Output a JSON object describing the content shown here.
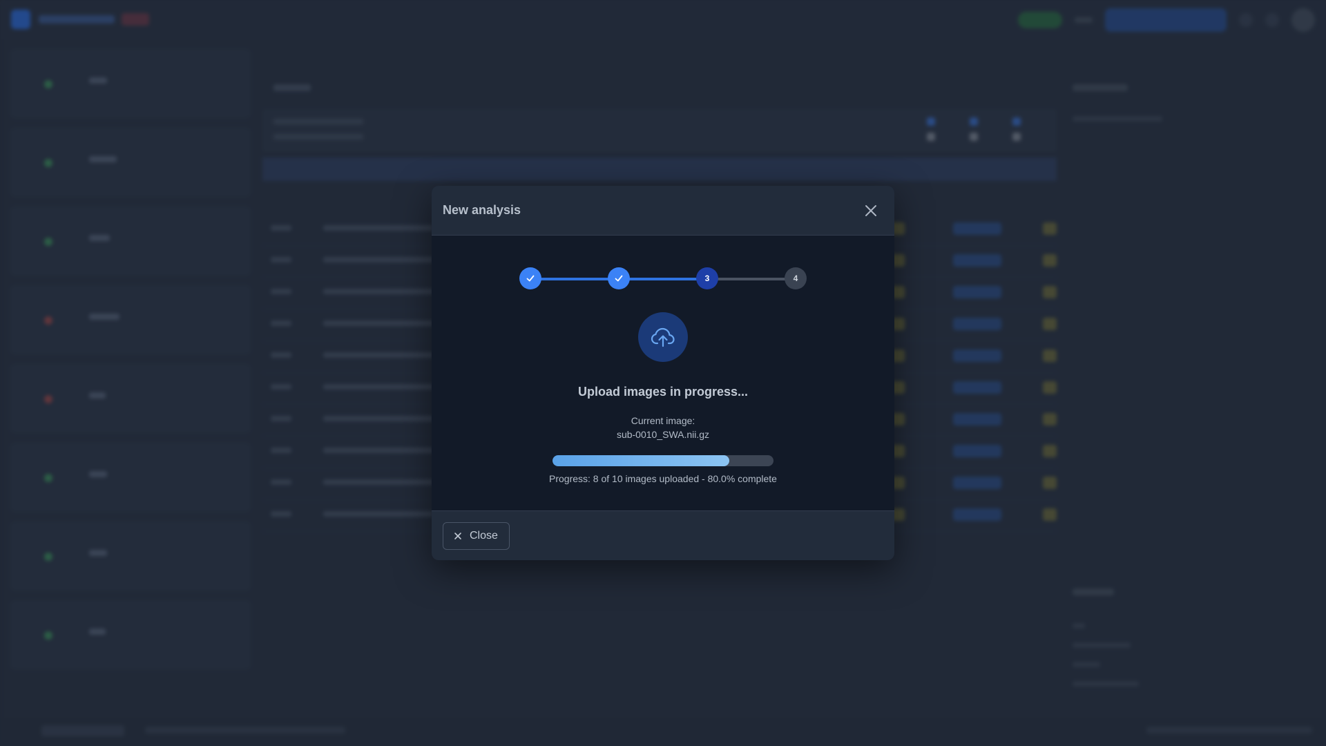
{
  "modal": {
    "title": "New analysis",
    "steps": [
      {
        "state": "done",
        "label": ""
      },
      {
        "state": "done",
        "label": ""
      },
      {
        "state": "active",
        "label": "3"
      },
      {
        "state": "pending",
        "label": "4"
      }
    ],
    "upload_title": "Upload images in progress...",
    "current_label": "Current image:",
    "current_file": "sub-0010_SWA.nii.gz",
    "progress_fraction": 0.8,
    "progress_text": "Progress: 8 of 10 images uploaded - 80.0% complete",
    "close_label": "Close"
  },
  "icons": {
    "close": "close-icon",
    "check": "check-icon",
    "upload": "cloud-upload-icon"
  },
  "colors": {
    "accent": "#3b82f6",
    "active_step": "#1e3fa8",
    "pending_step": "#3a4352",
    "modal_bg": "#121a28",
    "header_bg": "#222c3b"
  }
}
